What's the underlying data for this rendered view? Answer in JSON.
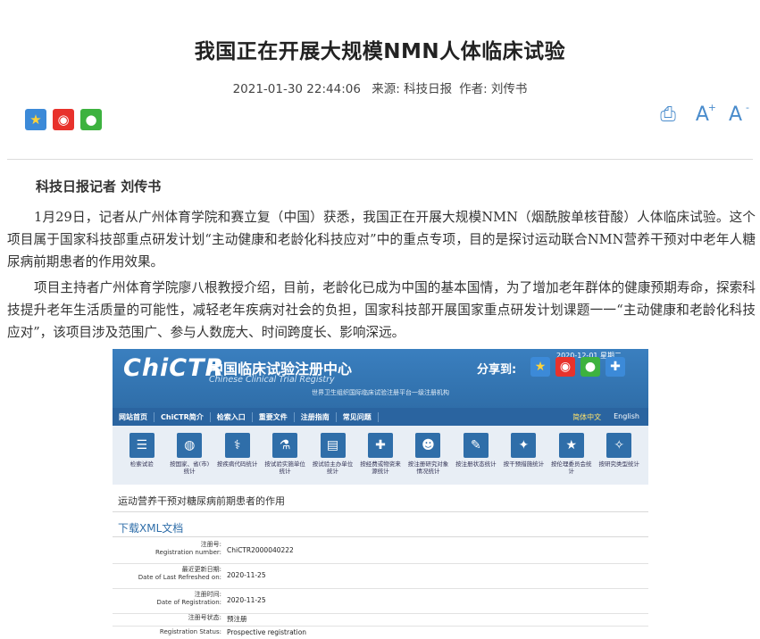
{
  "article": {
    "title": "我国正在开展大规模NMN人体临床试验",
    "date": "2021-01-30 22:44:06",
    "source": "来源: 科技日报",
    "author": "作者: 刘传书",
    "byline": "科技日报记者 刘传书",
    "paragraphs": [
      "1月29日，记者从广州体育学院和赛立复（中国）获悉，我国正在开展大规模NMN（烟酰胺单核苷酸）人体临床试验。这个项目属于国家科技部重点研发计划“主动健康和老龄化科技应对”中的重点专项，目的是探讨运动联合NMN营养干预对中老年人糖尿病前期患者的作用效果。",
      "项目主持者广州体育学院廖八根教授介绍，目前，老龄化已成为中国的基本国情，为了增加老年群体的健康预期寿命，探索科技提升老年生活质量的可能性，减轻老年疾病对社会的负担，国家科技部开展国家重点研发计划课题一一“主动健康和老龄化科技应对”，该项目涉及范围广、参与人数庞大、时间跨度长、影响深远。"
    ]
  },
  "share_icons": [
    "qzone-star-icon",
    "weibo-icon",
    "wechat-icon"
  ],
  "tools": {
    "print": "print-icon",
    "font_up": "A",
    "font_down": "A"
  },
  "embedded": {
    "logo": "ChiCTR",
    "name_cn": "中国临床试验注册中心",
    "name_en": "Chinese Clinical Trial Registry",
    "subtitle": "世界卫生组织国际临床试验注册平台一级注册机构",
    "date": "2020-12-01 星期二",
    "share_to": "分享到:",
    "nav": [
      "网站首页",
      "ChiCTR简介",
      "检索入口",
      "重要文件",
      "注册指南",
      "常见问题"
    ],
    "lang": [
      "简体中文",
      "English"
    ],
    "icons": [
      {
        "label": "检索试验",
        "glyph": "☰"
      },
      {
        "label": "按国家、省(市)统计",
        "glyph": "◍"
      },
      {
        "label": "按疾病代码统计",
        "glyph": "⚕"
      },
      {
        "label": "按试验实施单位统计",
        "glyph": "⚗"
      },
      {
        "label": "按试验主办单位统计",
        "glyph": "▤"
      },
      {
        "label": "按经费或物资来源统计",
        "glyph": "✚"
      },
      {
        "label": "按注册研究对象情况统计",
        "glyph": "☻"
      },
      {
        "label": "按注册状态统计",
        "glyph": "✎"
      },
      {
        "label": "按干预措施统计",
        "glyph": "✦"
      },
      {
        "label": "按伦理委员会统计",
        "glyph": "★"
      },
      {
        "label": "按研究类型统计",
        "glyph": "✧"
      }
    ],
    "project_title": "运动营养干预对糖尿病前期患者的作用",
    "xml_link": "下载XML文档",
    "rows": [
      {
        "label_cn": "注册号:",
        "label_en": "Registration number:",
        "value": "ChiCTR2000040222"
      },
      {
        "label_cn": "最近更新日期:",
        "label_en": "Date of Last Refreshed on:",
        "value": "2020-11-25"
      },
      {
        "label_cn": "注册时间:",
        "label_en": "Date of Registration:",
        "value": "2020-11-25"
      },
      {
        "label_cn": "注册号状态:",
        "label_en": "",
        "value": "预注册"
      },
      {
        "label_cn": "",
        "label_en": "Registration Status:",
        "value": "Prospective registration"
      }
    ]
  }
}
